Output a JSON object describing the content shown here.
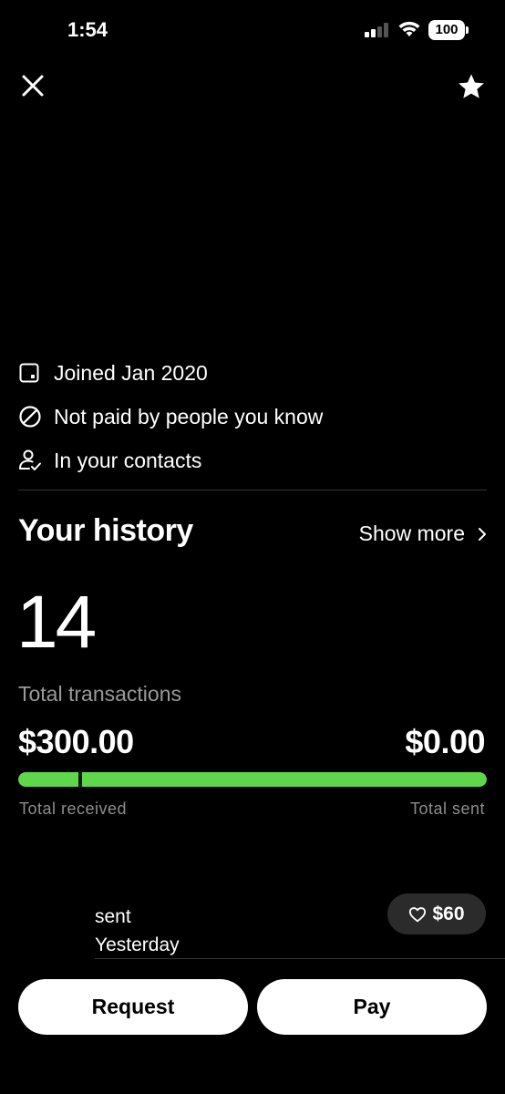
{
  "status_bar": {
    "time": "1:54",
    "battery": "100"
  },
  "header": {
    "close_icon": "close-icon",
    "favorite_icon": "star-icon"
  },
  "profile_info": [
    {
      "icon": "calendar-icon",
      "text": "Joined Jan 2020"
    },
    {
      "icon": "prohibited-icon",
      "text": "Not paid by people you know"
    },
    {
      "icon": "contact-check-icon",
      "text": "In your contacts"
    }
  ],
  "history": {
    "title": "Your history",
    "show_more": "Show more",
    "total_count": "14",
    "total_count_label": "Total transactions",
    "total_received_amount": "$300.00",
    "total_sent_amount": "$0.00",
    "total_received_label": "Total received",
    "total_sent_label": "Total sent",
    "received_fraction": 1.0,
    "bar_color": "#5ed84a"
  },
  "transaction": {
    "line1": "sent",
    "line2": "Yesterday",
    "badge_icon": "heart-icon",
    "amount": "$60"
  },
  "actions": {
    "request": "Request",
    "pay": "Pay"
  }
}
